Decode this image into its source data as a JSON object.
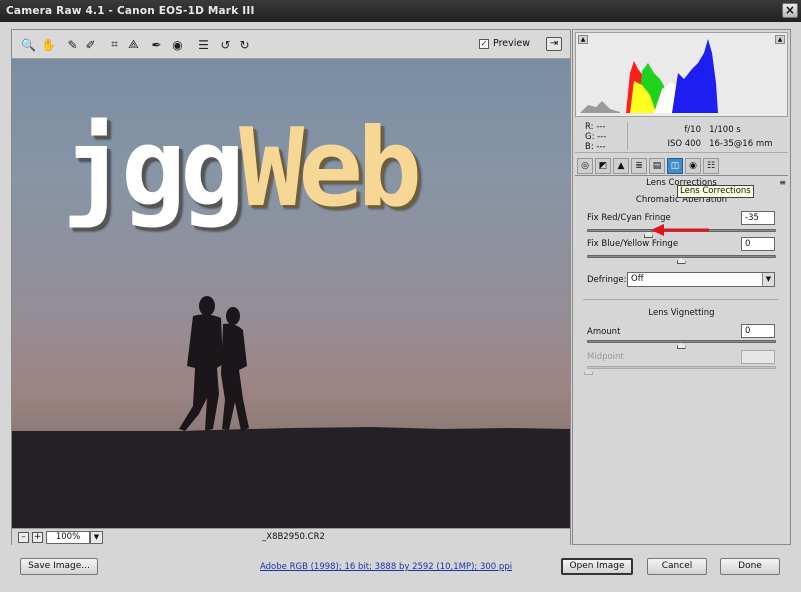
{
  "window": {
    "title": "Camera Raw 4.1  -  Canon EOS-1D Mark III",
    "close_glyph": "×"
  },
  "toolbar": {
    "tools": [
      {
        "name": "zoom-tool-icon",
        "glyph": "🔍"
      },
      {
        "name": "hand-tool-icon",
        "glyph": "✋"
      },
      {
        "name": "white-balance-tool-icon",
        "glyph": "✎"
      },
      {
        "name": "color-sampler-tool-icon",
        "glyph": "✐"
      },
      {
        "name": "crop-tool-icon",
        "glyph": "⌗"
      },
      {
        "name": "straighten-tool-icon",
        "glyph": "⟁"
      },
      {
        "name": "retouch-tool-icon",
        "glyph": "✒"
      },
      {
        "name": "red-eye-tool-icon",
        "glyph": "◉"
      },
      {
        "name": "preferences-icon",
        "glyph": "☰"
      },
      {
        "name": "rotate-left-icon",
        "glyph": "↺"
      },
      {
        "name": "rotate-right-icon",
        "glyph": "↻"
      }
    ],
    "preview_label": "Preview",
    "preview_checked": "✓",
    "fullscreen_glyph": "⇥"
  },
  "image": {
    "overlay_text_white": "jgg",
    "overlay_text_yellow": "Web"
  },
  "statusbar": {
    "zoom_minus": "–",
    "zoom_plus": "+",
    "zoom_level": "100%",
    "zoom_dropdown": "▼",
    "filename": "_X8B2950.CR2"
  },
  "readout": {
    "r": "R:   ---",
    "g": "G:   ---",
    "b": "B:   ---",
    "aperture": "f/10",
    "shutter": "1/100 s",
    "iso": "ISO 400",
    "lens": "16-35@16 mm"
  },
  "histogram": {
    "shadow_warning": "▲",
    "highlight_warning": "▲",
    "colors": {
      "red": "#ff1e1e",
      "green": "#1ed21e",
      "blue": "#1e1ef0",
      "yellow": "#ffff1e",
      "white": "#ffffff"
    }
  },
  "tabs": [
    {
      "name": "tab-basic",
      "glyph": "◎"
    },
    {
      "name": "tab-tone-curve",
      "glyph": "◩"
    },
    {
      "name": "tab-detail",
      "glyph": "▲"
    },
    {
      "name": "tab-hsl",
      "glyph": "≣"
    },
    {
      "name": "tab-split-toning",
      "glyph": "▤"
    },
    {
      "name": "tab-lens-corrections",
      "glyph": "◫"
    },
    {
      "name": "tab-camera-calibration",
      "glyph": "◉"
    },
    {
      "name": "tab-presets",
      "glyph": "☷"
    }
  ],
  "tooltip": "Lens Corrections",
  "panel": {
    "title": "Lens Corrections",
    "menu_glyph": "≡",
    "chromatic_aberration": {
      "title": "Chromatic Aberration",
      "red_cyan_label": "Fix Red/Cyan Fringe",
      "red_cyan_value": "-35",
      "red_cyan_level": -0.35,
      "blue_yellow_label": "Fix Blue/Yellow Fringe",
      "blue_yellow_value": "0",
      "blue_yellow_level": 0,
      "defringe_label": "Defringe:",
      "defringe_value": "Off"
    },
    "vignetting": {
      "title": "Lens Vignetting",
      "amount_label": "Amount",
      "amount_value": "0",
      "amount_level": 0,
      "midpoint_label": "Midpoint",
      "midpoint_value": ""
    },
    "annotation_arrow_color": "#e0141e"
  },
  "footer": {
    "save_label": "Save Image...",
    "info_link": "Adobe RGB (1998); 16 bit; 3888 by 2592 (10,1MP); 300 ppi",
    "open_label": "Open Image",
    "cancel_label": "Cancel",
    "done_label": "Done"
  }
}
